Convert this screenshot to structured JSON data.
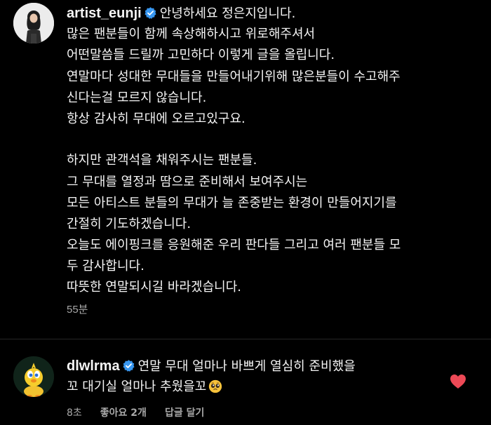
{
  "post": {
    "username": "artist_eunji",
    "first_line": "안녕하세요 정은지입니다.",
    "lines": [
      "많은 팬분들이 함께 속상해하시고 위로해주셔서",
      "어떤말씀들 드릴까 고민하다 이렇게 글을 올립니다.",
      "연말마다 성대한 무대들을 만들어내기위해 많은분들이 수고해주",
      "신다는걸 모르지 않습니다.",
      "항상 감사히 무대에 오르고있구요.",
      "",
      "하지만 관객석을 채워주시는 팬분들.",
      "그 무대를 열정과 땀으로 준비해서 보여주시는",
      "모든 아티스트 분들의 무대가 늘 존중받는 환경이 만들어지기를",
      "간절히 기도하겠습니다.",
      "오늘도 에이핑크를 응원해준 우리 판다들 그리고 여러 팬분들 모",
      "두 감사합니다.",
      "따뜻한 연말되시길 바라겠습니다."
    ],
    "timestamp": "55분"
  },
  "reply": {
    "username": "dlwlrma",
    "text_line1": "연말 무대 얼마나 바쁘게 열심히 준비했을",
    "text_line2": "꼬 대기실 얼마나 추웠을꼬",
    "emoji": "pleading-face-emoji",
    "time": "8초",
    "likes": "좋아요 2개",
    "reply_label": "답글 달기"
  },
  "colors": {
    "background": "#000000",
    "text": "#f5f5f5",
    "meta": "#a8a8a8",
    "verified": "#3897f0",
    "heart": "#ed4956"
  }
}
